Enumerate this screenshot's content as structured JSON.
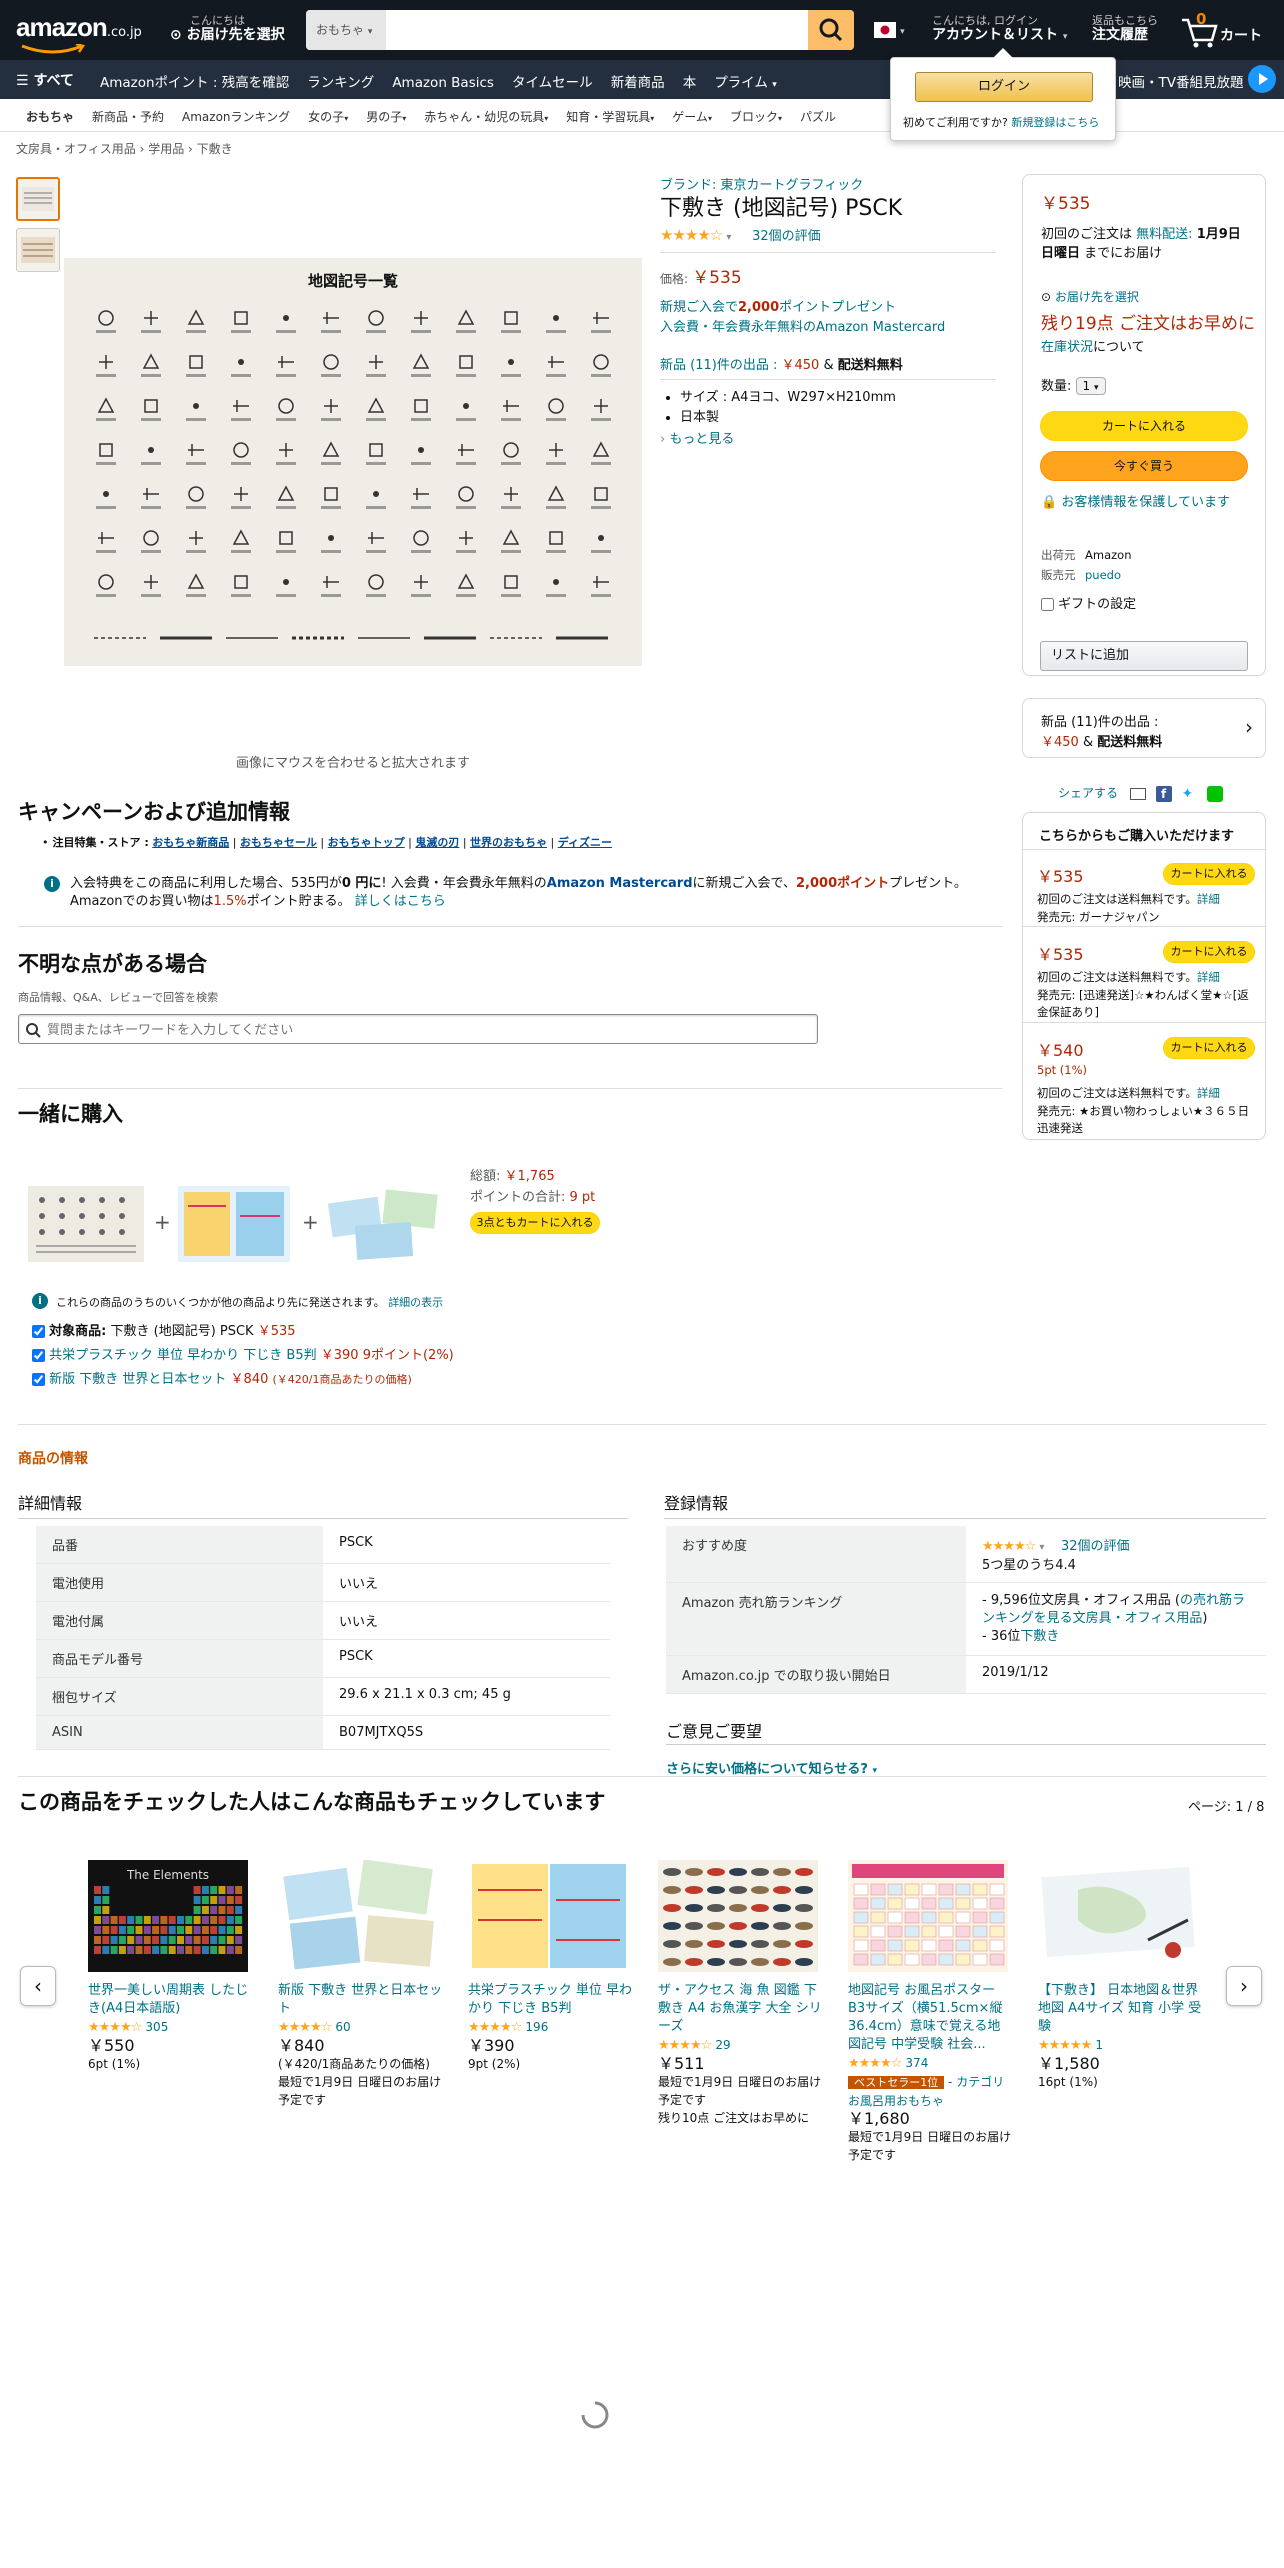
{
  "header": {
    "logo": "amazon",
    "logo_suffix": ".co.jp",
    "deliver_greeting": "こんにちは",
    "deliver_text": "お届け先を選択",
    "search_category": "おもちゃ",
    "search_placeholder": "",
    "account_line1": "こんにちは, ログイン",
    "account_line2": "アカウント＆リスト",
    "orders_line1": "返品もこちら",
    "orders_line2": "注文履歴",
    "cart_count": "0",
    "cart_label": "カート"
  },
  "nav": {
    "all_label": "すべて",
    "items": [
      "Amazonポイント : 残高を確認",
      "ランキング",
      "Amazon Basics",
      "タイムセール",
      "新着商品",
      "本",
      "プライム"
    ],
    "right_label": "映画・TV番組見放題"
  },
  "category_nav": {
    "items": [
      "おもちゃ",
      "新商品・予約",
      "Amazonランキング",
      "女の子",
      "男の子",
      "赤ちゃん・幼児の玩具",
      "知育・学習玩具",
      "ゲーム",
      "ブロック",
      "パズル"
    ]
  },
  "signin_popup": {
    "button": "ログイン",
    "text": "初めてご利用ですか?",
    "link": "新規登録はこちら"
  },
  "breadcrumb": [
    "文房具・オフィス用品",
    "学用品",
    "下敷き"
  ],
  "gallery": {
    "caption": "画像にマウスを合わせると拡大されます",
    "image_title": "地図記号一覧"
  },
  "product": {
    "brand": "ブランド: 東京カートグラフィック",
    "title": "下敷き (地図記号) PSCK",
    "rating_count": "32個の評価",
    "price_label": "価格:",
    "price": "￥535",
    "promo_line1_pre": "新規ご入会で",
    "promo_points": "2,000",
    "promo_line1_post": "ポイントプレゼント",
    "promo_line2": "入会費・年会費永年無料のAmazon Mastercard",
    "new_offers_pre": "新品 (11)件の出品 :",
    "new_offers_price": "￥450",
    "new_offers_amp": "&",
    "new_offers_ship": "配送料無料",
    "bullets": [
      "サイズ : A4ヨコ、W297×H210mm",
      "日本製"
    ],
    "more_link": "もっと見る"
  },
  "buybox": {
    "price": "￥535",
    "delivery_pre": "初回のご注文は",
    "delivery_free": "無料配送:",
    "delivery_date": "1月9日 日曜日",
    "delivery_post": "までにお届け",
    "deliver_to": "お届け先を選択",
    "stock_red": "残り19点 ご注文はお早めに",
    "stock_link": "在庫状況",
    "stock_post": "について",
    "qty_label": "数量:",
    "qty_value": "1",
    "add_to_cart": "カートに入れる",
    "buy_now": "今すぐ買う",
    "secure": "お客様情報を保護しています",
    "ships_from_label": "出荷元",
    "ships_from": "Amazon",
    "sold_by_label": "販売元",
    "sold_by": "puedo",
    "gift": "ギフトの設定",
    "add_to_list": "リストに追加"
  },
  "new_offers_box": {
    "line1": "新品 (11)件の出品 :",
    "price": "￥450",
    "amp": "&",
    "ship": "配送料無料"
  },
  "share": {
    "label": "シェアする"
  },
  "other_sellers": {
    "title": "こちらからもご購入いただけます",
    "offers": [
      {
        "price": "￥535",
        "button": "カートに入れる",
        "ship": "初回のご注文は送料無料です。",
        "detail": "詳細",
        "seller": "発売元: ガーナジャパン",
        "pts": ""
      },
      {
        "price": "￥535",
        "button": "カートに入れる",
        "ship": "初回のご注文は送料無料です。",
        "detail": "詳細",
        "seller": "発売元: [迅速発送]☆★わんばく堂★☆[返金保証あり]",
        "pts": ""
      },
      {
        "price": "￥540",
        "button": "カートに入れる",
        "ship": "初回のご注文は送料無料です。",
        "detail": "詳細",
        "seller": "発売元: ★お買い物わっしょい★３６５日迅速発送",
        "pts": "5pt (1%)"
      }
    ]
  },
  "campaign": {
    "title": "キャンペーンおよび追加情報",
    "store_label": "注目特集・ストア :",
    "store_links": [
      "おもちゃ新商品",
      "おもちゃセール",
      "おもちゃトップ",
      "鬼滅の刃",
      "世界のおもちゃ",
      "ディズニー"
    ],
    "info_text_pre": "入会特典をこの商品に利用した場合、535円が",
    "info_zero": "0 円に",
    "info_text_mid": "! 入会費・年会費永年無料の",
    "info_card": "Amazon Mastercard",
    "info_text_mid2": "に新規ご入会で、",
    "info_points": "2,000ポイント",
    "info_text_post": "プレゼント。Amazonでのお買い物は",
    "info_pct": "1.5%",
    "info_text_end": "ポイント貯まる。",
    "info_link": "詳しくはこちら"
  },
  "questions": {
    "title": "不明な点がある場合",
    "subtitle": "商品情報、Q&A、レビューで回答を検索",
    "placeholder": "質問またはキーワードを入力してください"
  },
  "bought_together": {
    "title": "一緒に購入",
    "total_label": "総額:",
    "total": "￥1,765",
    "points_label": "ポイントの合計:",
    "points": "9 pt",
    "button": "3点ともカートに入れる",
    "notice": "これらの商品のうちのいくつかが他の商品より先に発送されます。",
    "notice_link": "詳細の表示",
    "items": [
      {
        "prefix": "対象商品:",
        "name": "下敷き (地図記号) PSCK",
        "price": "￥535",
        "extra": ""
      },
      {
        "prefix": "",
        "name": "共栄プラスチック 単位 早わかり 下じき B5判",
        "price": "￥390",
        "extra": "9ポイント(2%)"
      },
      {
        "prefix": "",
        "name": "新版 下敷き 世界と日本セット",
        "price": "￥840",
        "extra": "(￥420/1商品あたりの価格)"
      }
    ]
  },
  "product_info": {
    "section_title": "商品の情報",
    "details_title": "詳細情報",
    "details": [
      {
        "k": "品番",
        "v": "PSCK"
      },
      {
        "k": "電池使用",
        "v": "いいえ"
      },
      {
        "k": "電池付属",
        "v": "いいえ"
      },
      {
        "k": "商品モデル番号",
        "v": "PSCK"
      },
      {
        "k": "梱包サイズ",
        "v": "29.6 x 21.1 x 0.3 cm; 45 g"
      },
      {
        "k": "ASIN",
        "v": "B07MJTXQ5S"
      }
    ],
    "reg_title": "登録情報",
    "reg_rating_label": "おすすめ度",
    "reg_rating_count": "32個の評価",
    "reg_rating_text": "5つ星のうち4.4",
    "rank_label": "Amazon 売れ筋ランキング",
    "rank_line1_pre": "- 9,596位文房具・オフィス用品 (",
    "rank_line1_link": "の売れ筋ランキングを見る文房具・オフィス用品",
    "rank_line1_post": ")",
    "rank_line2_pre": "- 36位",
    "rank_line2_link": "下敷き",
    "date_label": "Amazon.co.jp での取り扱い開始日",
    "date": "2019/1/12",
    "feedback_title": "ご意見ご要望",
    "feedback_link": "さらに安い価格について知らせる?"
  },
  "carousel": {
    "title": "この商品をチェックした人はこんな商品もチェックしています",
    "page": "ページ: 1 / 8",
    "items": [
      {
        "title": "世界一美しい周期表 したじき(A4日本語版)",
        "count": "305",
        "price": "￥550",
        "sub1": "6pt (1%)",
        "sub2": "",
        "badge": "",
        "img_label": "The Elements"
      },
      {
        "title": "新版 下敷き 世界と日本セット",
        "count": "60",
        "price": "￥840",
        "sub1": "(￥420/1商品あたりの価格)",
        "sub2": "最短で1月9日 日曜日のお届け予定です",
        "badge": "",
        "img_label": ""
      },
      {
        "title": "共栄プラスチック 単位 早わかり 下じき B5判",
        "count": "196",
        "price": "￥390",
        "sub1": "9pt (2%)",
        "sub2": "",
        "badge": "",
        "img_label": ""
      },
      {
        "title": "ザ・アクセス 海 魚 図鑑 下敷き A4 お魚漢字 大全 シリーズ",
        "count": "29",
        "price": "￥511",
        "sub1": "最短で1月9日 日曜日のお届け予定です",
        "sub2": "残り10点 ご注文はお早めに",
        "badge": "",
        "img_label": ""
      },
      {
        "title": "地図記号 お風呂ポスター B3サイズ（横51.5cm×縦36.4cm）意味で覚える地図記号 中学受験 社会...",
        "count": "374",
        "price": "￥1,680",
        "sub1": "最短で1月9日 日曜日のお届け予定です",
        "sub2": "",
        "badge": "ベストセラー1位",
        "badge_cat": "- カテゴリ お風呂用おもちゃ",
        "img_label": ""
      },
      {
        "title": "【下敷き】 日本地図＆世界地図 A4サイズ 知育 小学 受験",
        "count": "1",
        "price": "￥1,580",
        "sub1": "16pt (1%)",
        "sub2": "",
        "badge": "",
        "img_label": ""
      }
    ]
  },
  "colors": {
    "nav_bg": "#131921",
    "subnav_bg": "#232f3e",
    "price": "#b12704",
    "link": "#007185",
    "button_yellow": "#ffd814",
    "button_orange": "#ffa41c",
    "star": "#ffa41c"
  }
}
